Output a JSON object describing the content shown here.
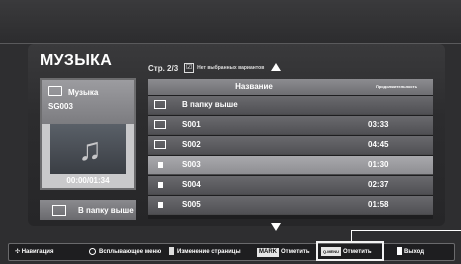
{
  "app": {
    "title": "МУЗЫКА"
  },
  "page_info": {
    "label": "Стр. 2/3",
    "selected_label": "Нет выбранных вариантов",
    "checkbox_mark": "☑"
  },
  "folder_card": {
    "name": "Музыка",
    "subtitle": "SG003",
    "time": "00:00/01:34"
  },
  "up_button": {
    "label": "В папку выше"
  },
  "table": {
    "headers": {
      "name": "Название",
      "duration": "Продолжительность"
    },
    "rows": [
      {
        "name": "В папку выше",
        "duration": "",
        "icon": "folder-up-icon"
      },
      {
        "name": "S001",
        "duration": "03:33",
        "icon": "folder-icon"
      },
      {
        "name": "S002",
        "duration": "04:45",
        "icon": "folder-icon"
      },
      {
        "name": "S003",
        "duration": "01:30",
        "icon": "audio-file-icon"
      },
      {
        "name": "S004",
        "duration": "02:37",
        "icon": "audio-file-icon"
      },
      {
        "name": "S005",
        "duration": "01:58",
        "icon": "audio-file-icon"
      }
    ],
    "selected_index": 3
  },
  "footer": {
    "nav": "Навигация",
    "popup": "Всплывающее меню",
    "page_change": "Изменение страницы",
    "mark_tag": "MARK",
    "mark_label": "Отметить",
    "qmenu_tag": "Q.MENU",
    "qmenu_label": "Отметить",
    "exit": "Выход"
  },
  "colors": {
    "background": "#2e2e30",
    "selected_row": "#a9a9ad",
    "row": "#606064"
  }
}
